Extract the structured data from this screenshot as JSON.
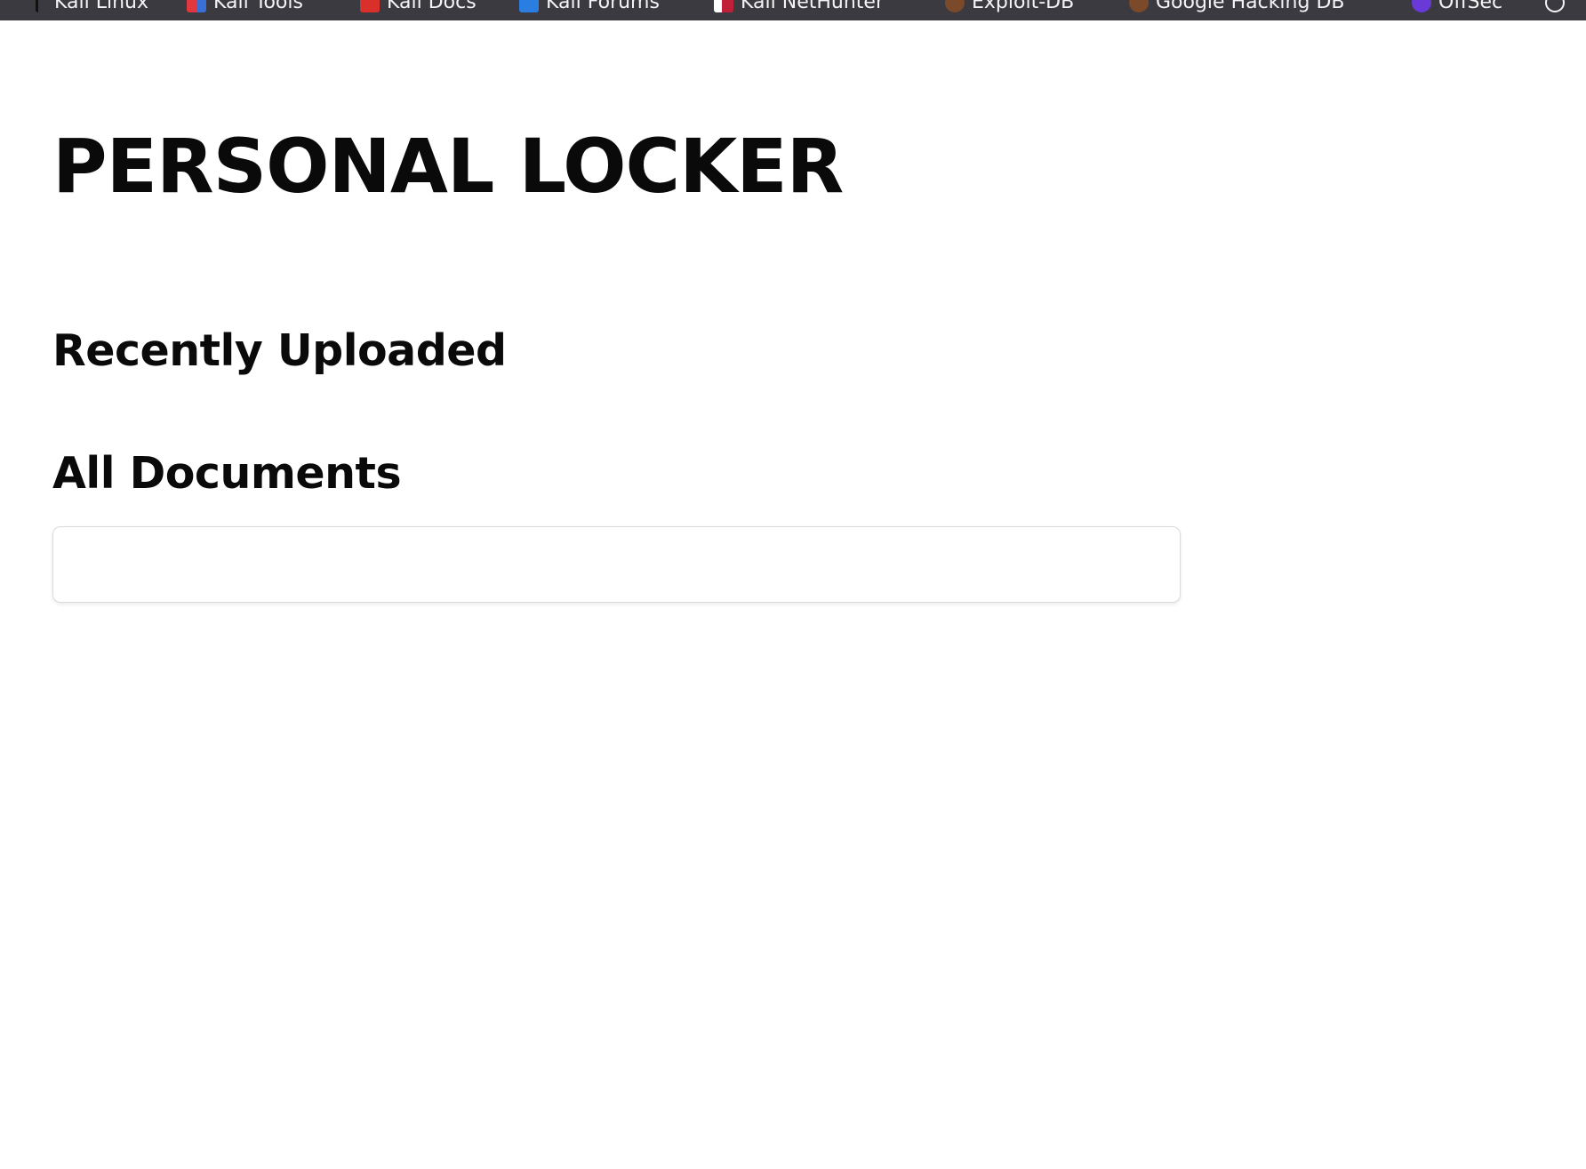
{
  "bookmarks": [
    {
      "label": "Kali Linux",
      "icon": "kali-dragon-icon",
      "color": "#1a1a1a"
    },
    {
      "label": "Kali Tools",
      "icon": "kali-tools-icon",
      "color": "#e0383e"
    },
    {
      "label": "Kali Docs",
      "icon": "kali-docs-icon",
      "color": "#d9302c"
    },
    {
      "label": "Kali Forums",
      "icon": "kali-forums-icon",
      "color": "#2a7de1"
    },
    {
      "label": "Kali NetHunter",
      "icon": "kali-nethunter-icon",
      "color": "#c0203a"
    },
    {
      "label": "Exploit-DB",
      "icon": "exploit-db-icon",
      "color": "#a85a2a"
    },
    {
      "label": "Google Hacking DB",
      "icon": "ghdb-icon",
      "color": "#a85a2a"
    },
    {
      "label": "OffSec",
      "icon": "offsec-icon",
      "color": "#6a3ad8"
    }
  ],
  "page": {
    "title": "PERSONAL LOCKER",
    "recently_uploaded_heading": "Recently Uploaded",
    "all_documents_heading": "All Documents"
  }
}
